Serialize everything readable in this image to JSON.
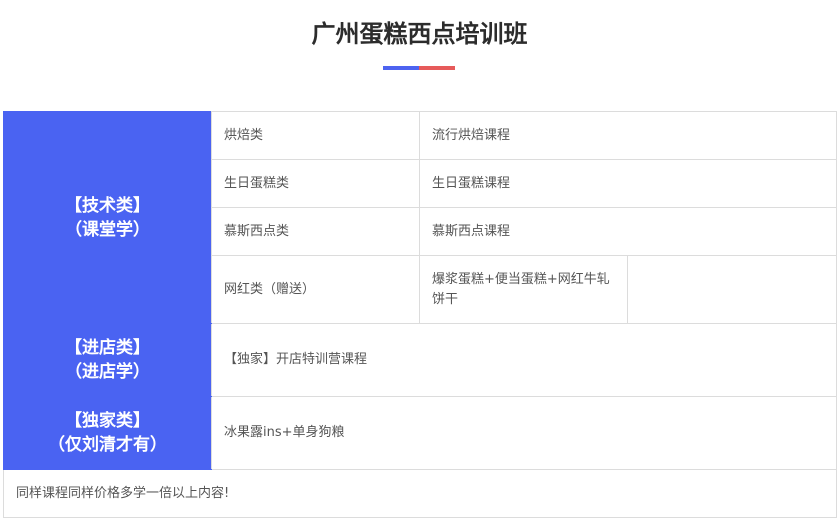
{
  "page": {
    "title": "广州蛋糕西点培训班"
  },
  "table": {
    "technical": {
      "category_line1": "【技术类】",
      "category_line2": "（课堂学）",
      "rows": [
        {
          "type": "烘焙类",
          "course": "流行烘焙课程"
        },
        {
          "type": "生日蛋糕类",
          "course": "生日蛋糕课程"
        },
        {
          "type": "慕斯西点类",
          "course": "慕斯西点课程"
        },
        {
          "type": "网红类（赠送）",
          "course": "爆浆蛋糕+便当蛋糕+网红牛轧饼干"
        }
      ]
    },
    "store": {
      "category_line1": "【进店类】",
      "category_line2": "（进店学）",
      "content": "【独家】开店特训营课程"
    },
    "exclusive": {
      "category_line1": "【独家类】",
      "category_line2": "（仅刘清才有）",
      "content": "冰果露ins+单身狗粮"
    },
    "footer": "同样课程同样价格多学一倍以上内容!"
  },
  "colors": {
    "category_bg": "#4a63f2",
    "underline_left": "#4d63f0",
    "underline_right": "#e65a5a"
  }
}
